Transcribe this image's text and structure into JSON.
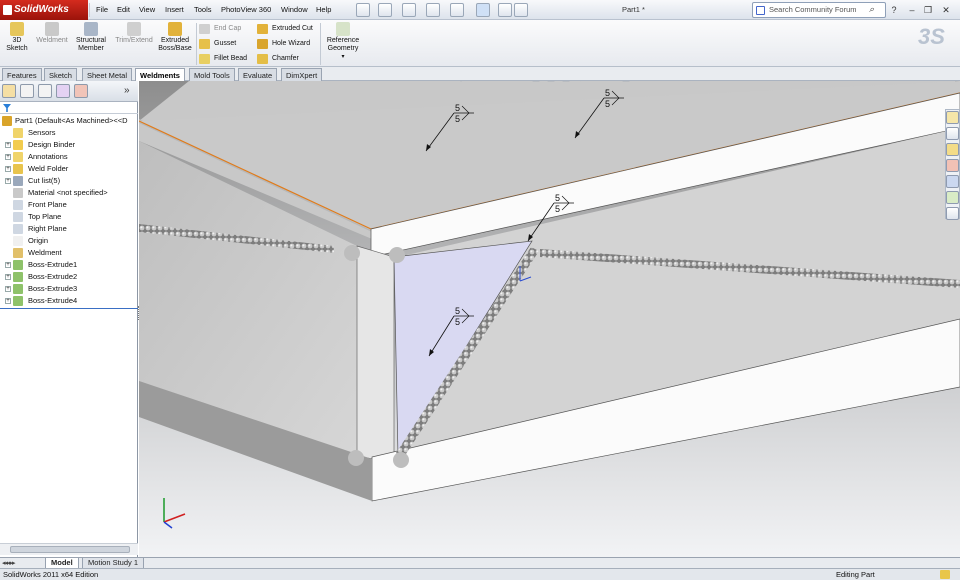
{
  "app": {
    "brand": "SolidWorks",
    "doc_title": "Part1 *"
  },
  "menu": [
    "File",
    "Edit",
    "View",
    "Insert",
    "Tools",
    "PhotoView 360",
    "Window",
    "Help"
  ],
  "search": {
    "placeholder": "Search Community Forum"
  },
  "ribbon": {
    "big_buttons": [
      {
        "label": "3D\nSketch",
        "enabled": true
      },
      {
        "label": "Weldment",
        "enabled": false
      },
      {
        "label": "Structural\nMember",
        "enabled": true
      },
      {
        "label": "Trim/Extend",
        "enabled": false
      },
      {
        "label": "Extruded\nBoss/Base",
        "enabled": true
      }
    ],
    "small_buttons": [
      {
        "label": "End Cap",
        "enabled": false
      },
      {
        "label": "Gusset",
        "enabled": true
      },
      {
        "label": "Fillet Bead",
        "enabled": true
      },
      {
        "label": "Extruded Cut",
        "enabled": true
      },
      {
        "label": "Hole Wizard",
        "enabled": true
      },
      {
        "label": "Chamfer",
        "enabled": true
      }
    ],
    "reference_geometry": "Reference\nGeometry"
  },
  "command_tabs": [
    "Features",
    "Sketch",
    "Sheet Metal",
    "Weldments",
    "Mold Tools",
    "Evaluate",
    "DimXpert"
  ],
  "active_command_tab": "Weldments",
  "feature_tree": [
    {
      "label": "Part1  (Default<As Machined><<D",
      "level": 0,
      "expand": false,
      "icon": "part-icon"
    },
    {
      "label": "Sensors",
      "level": 1,
      "expand": false,
      "icon": "sensor-icon"
    },
    {
      "label": "Design Binder",
      "level": 1,
      "expand": true,
      "icon": "binder-icon"
    },
    {
      "label": "Annotations",
      "level": 1,
      "expand": true,
      "icon": "annotation-icon"
    },
    {
      "label": "Weld Folder",
      "level": 1,
      "expand": true,
      "icon": "folder-icon"
    },
    {
      "label": "Cut list(5)",
      "level": 1,
      "expand": true,
      "icon": "cutlist-icon"
    },
    {
      "label": "Material <not specified>",
      "level": 1,
      "expand": false,
      "icon": "material-icon"
    },
    {
      "label": "Front Plane",
      "level": 1,
      "expand": false,
      "icon": "plane-icon"
    },
    {
      "label": "Top Plane",
      "level": 1,
      "expand": false,
      "icon": "plane-icon"
    },
    {
      "label": "Right Plane",
      "level": 1,
      "expand": false,
      "icon": "plane-icon"
    },
    {
      "label": "Origin",
      "level": 1,
      "expand": false,
      "icon": "origin-icon"
    },
    {
      "label": "Weldment",
      "level": 1,
      "expand": false,
      "icon": "weldment-icon"
    },
    {
      "label": "Boss-Extrude1",
      "level": 1,
      "expand": true,
      "icon": "extrude-icon"
    },
    {
      "label": "Boss-Extrude2",
      "level": 1,
      "expand": true,
      "icon": "extrude-icon"
    },
    {
      "label": "Boss-Extrude3",
      "level": 1,
      "expand": true,
      "icon": "extrude-icon"
    },
    {
      "label": "Boss-Extrude4",
      "level": 1,
      "expand": true,
      "icon": "extrude-icon"
    }
  ],
  "bottom_tabs": [
    "Model",
    "Motion Study 1"
  ],
  "active_bottom_tab": "Model",
  "status": {
    "left": "SolidWorks 2011 x64 Edition",
    "right": "Editing Part"
  },
  "weld_symbols": [
    {
      "top": "5",
      "bottom": "5"
    },
    {
      "top": "5",
      "bottom": "5"
    },
    {
      "top": "5",
      "bottom": "5"
    },
    {
      "top": "5",
      "bottom": "5"
    }
  ],
  "colors": {
    "brand_red": "#c8241a",
    "viewport_top": "#8f8f8f",
    "viewport_bottom": "#f4f5f7",
    "gusset": "#d9d9f2",
    "edge_highlight": "#e07b1a"
  }
}
